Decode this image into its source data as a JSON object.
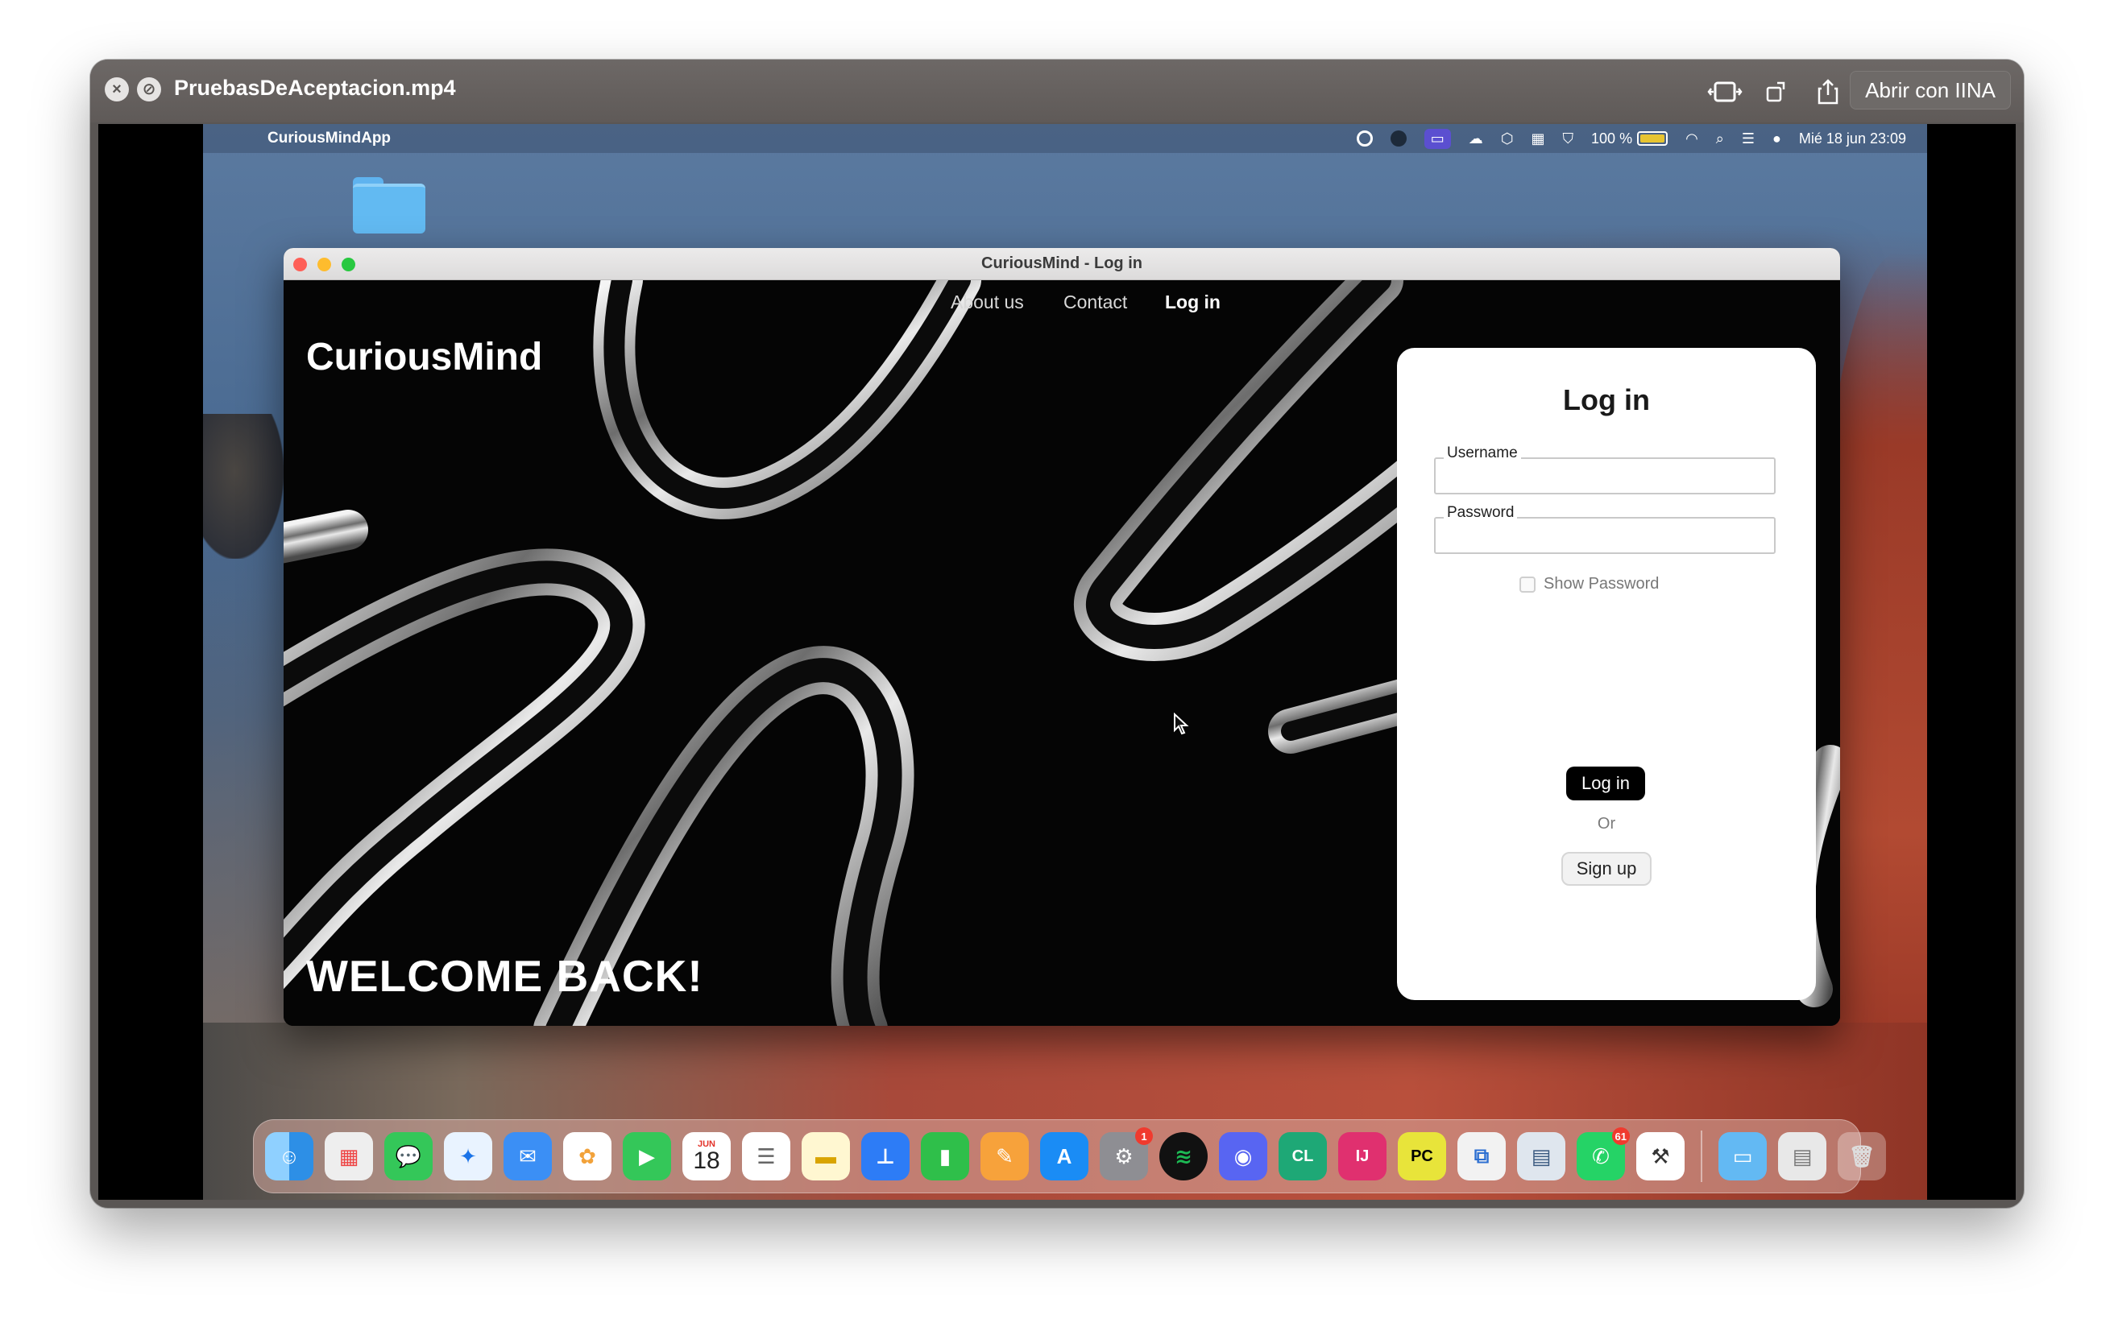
{
  "quicklook": {
    "title": "PruebasDeAceptacion.mp4",
    "open_with_label": "Abrir con IINA"
  },
  "menubar": {
    "app_name": "CuriousMindApp",
    "battery": "100 %",
    "datetime": "Mié 18 jun 23:09"
  },
  "app": {
    "window_title": "CuriousMind - Log in",
    "brand": "CuriousMind",
    "nav": {
      "about": "About us",
      "contact": "Contact",
      "login": "Log in"
    },
    "welcome": "WELCOME BACK!",
    "login_card": {
      "title": "Log in",
      "username_label": "Username",
      "username_value": "",
      "password_label": "Password",
      "password_value": "",
      "show_password_label": "Show Password",
      "login_button": "Log in",
      "or_text": "Or",
      "signup_button": "Sign up"
    }
  },
  "dock": {
    "calendar_month": "JUN",
    "calendar_day": "18",
    "settings_badge": "1",
    "whatsapp_badge": "61",
    "apps": [
      "Finder",
      "Launchpad",
      "Messages",
      "Safari",
      "Mail",
      "Photos",
      "FaceTime",
      "Calendar",
      "Reminders",
      "Notes",
      "Keynote",
      "Numbers",
      "Pages",
      "App Store",
      "System Settings",
      "Spotify",
      "Discord",
      "CLion",
      "IntelliJ IDEA",
      "PyCharm",
      "VMware Fusion",
      "Preview",
      "WhatsApp",
      "Xcode Instruments",
      "Downloads",
      "Finder Window",
      "Trash"
    ],
    "colors": {
      "finder": "#2d8fe6",
      "spotify": "#1db954",
      "discord": "#5865f2",
      "whatsapp": "#25d366"
    }
  }
}
